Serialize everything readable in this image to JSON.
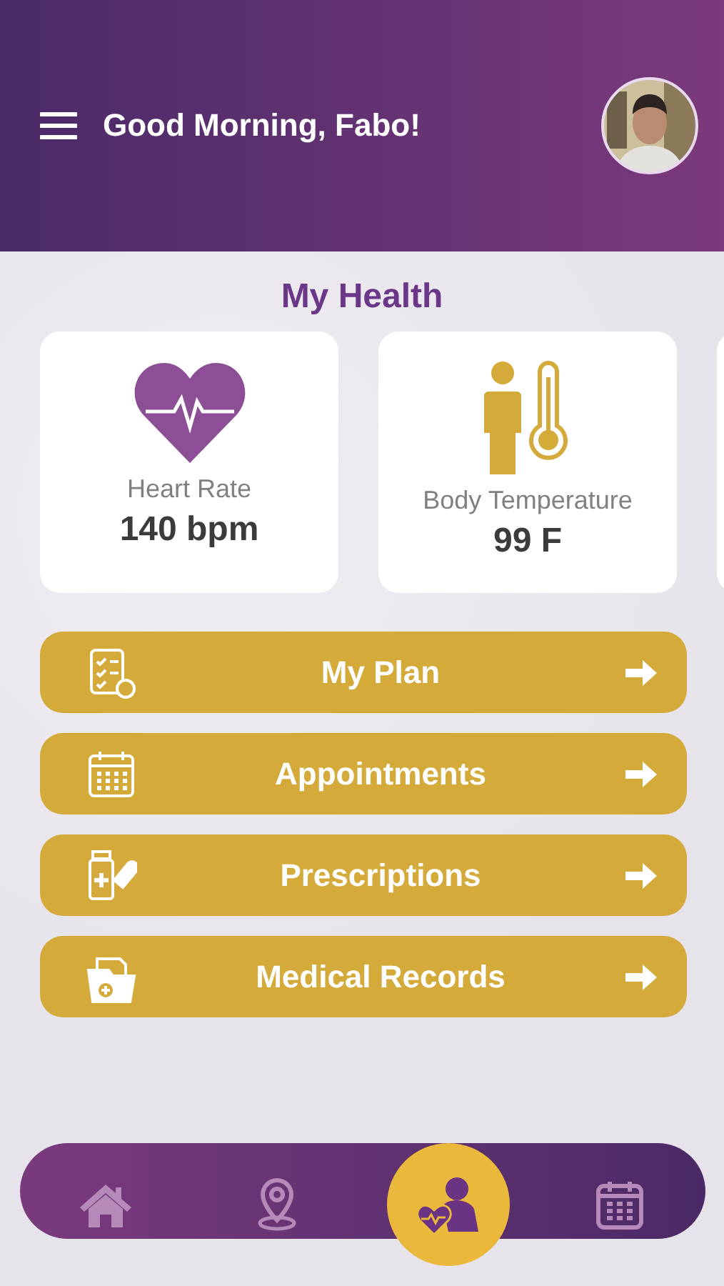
{
  "header": {
    "greeting": "Good Morning, Fabo!"
  },
  "section_title": "My Health",
  "metrics": [
    {
      "kind": "heart",
      "label": "Heart Rate",
      "value": "140 bpm"
    },
    {
      "kind": "temperature",
      "label": "Body Temperature",
      "value": "99 F"
    }
  ],
  "menu": [
    {
      "kind": "plan",
      "label": "My Plan"
    },
    {
      "kind": "calendar",
      "label": "Appointments"
    },
    {
      "kind": "medicine",
      "label": "Prescriptions"
    },
    {
      "kind": "records",
      "label": "Medical Records"
    }
  ],
  "nav": [
    {
      "kind": "home",
      "selected": false
    },
    {
      "kind": "location",
      "selected": false
    },
    {
      "kind": "health",
      "selected": true
    },
    {
      "kind": "calendar",
      "selected": false
    }
  ]
}
